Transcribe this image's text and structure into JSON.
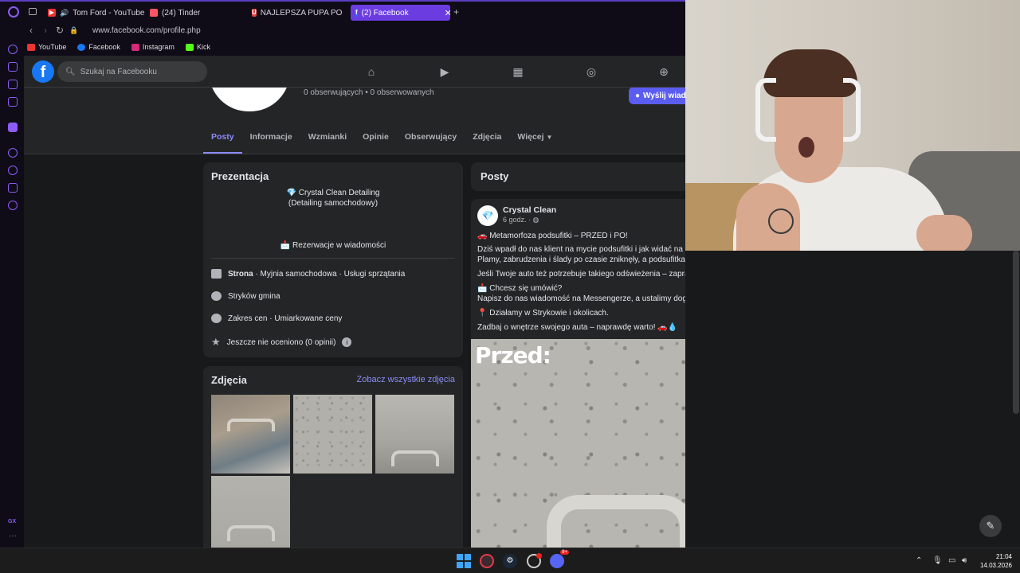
{
  "browser": {
    "tabs": [
      {
        "label": "Tom Ford - YouTube",
        "icon": "youtube-icon",
        "color": "#e33"
      },
      {
        "label": "(24) Tinder",
        "icon": "tinder-icon",
        "color": "#fd5564"
      },
      {
        "label": "NAJLEPSZA PUPA POLSK",
        "icon": "u-icon",
        "color": "#d44"
      },
      {
        "label": "(2) Facebook",
        "icon": "facebook-icon",
        "color": "#1877f2",
        "active": true
      }
    ],
    "url": "www.facebook.com/profile.php",
    "bookmarks": [
      {
        "label": "YouTube",
        "color": "#e33"
      },
      {
        "label": "Facebook",
        "color": "#1877f2"
      },
      {
        "label": "Instagram",
        "color": "#d62976"
      },
      {
        "label": "Kick",
        "color": "#53fc18"
      }
    ],
    "gx_label": "GX"
  },
  "fb": {
    "search_placeholder": "Szukaj na Facebooku",
    "nav_icons": [
      "home-icon",
      "video-icon",
      "marketplace-icon",
      "groups-icon",
      "gaming-icon"
    ],
    "followers_text": "0 obserwujących • 0 obserwowanych",
    "message_button": "Wyślij wiad",
    "profile_tabs": [
      "Posty",
      "Informacje",
      "Wzmianki",
      "Opinie",
      "Obserwujący",
      "Zdjęcia",
      "Więcej"
    ],
    "intro": {
      "title": "Prezentacja",
      "bio_line1": "💎 Crystal Clean Detailing",
      "bio_line2": "(Detailing samochodowy)",
      "bio_line3": "📩 Rezerwacje w wiadomości",
      "page_type_bold": "Strona",
      "page_type_rest": " · Myjnia samochodowa · Usługi sprzątania",
      "location": "Stryków gmina",
      "price": "Zakres cen · Umiarkowane ceny",
      "rating": "Jeszcze nie oceniono (0 opinii)"
    },
    "photos": {
      "title": "Zdjęcia",
      "see_all": "Zobacz wszystkie zdjęcia"
    },
    "posts": {
      "title": "Posty",
      "author": "Crystal Clean",
      "time": "6 godz. · ",
      "lines": [
        "🚗 Metamorfoza podsufitki – PRZED i PO!",
        "Dziś wpadł do nas klient na mycie podsufitki i jak widać na zdjęciach – różnica jest ogromna. 😊",
        "Plamy, zabrudzenia i ślady po czasie zniknęły, a podsufitka znów wygląda świeżo i czysto.",
        "Jeśli Twoje auto też potrzebuje takiego odświeżenia – zapraszamy! ✨",
        "📩 Chcesz się umówić?",
        "Napisz do nas wiadomość na Messengerze, a ustalimy dogodny termin.",
        "📍 Działamy w Strykowie i okolicach.",
        "Zadbaj o wnętrze swojego auta – naprawdę warto! 🚗💧"
      ],
      "photo_caption": "Przed:"
    }
  },
  "taskbar": {
    "time": "21:04",
    "date": "14.03.2026",
    "discord_badge": "9+"
  }
}
